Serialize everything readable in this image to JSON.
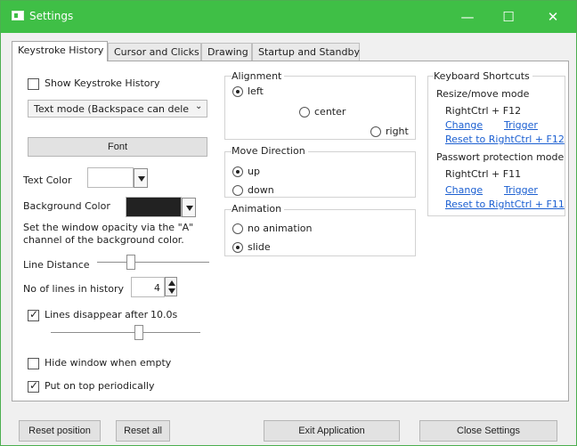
{
  "window": {
    "title": "Settings",
    "controls": {
      "minimize": "—",
      "maximize": "☐",
      "close": "✕"
    }
  },
  "tabs": [
    {
      "label": "Keystroke History",
      "active": true
    },
    {
      "label": "Cursor and Clicks",
      "active": false
    },
    {
      "label": "Drawing",
      "active": false
    },
    {
      "label": "Startup and Standby",
      "active": false
    }
  ],
  "keystroke_history": {
    "show_label": "Show Keystroke History",
    "mode_value": "Text mode (Backspace can dele",
    "font_button": "Font",
    "text_color_label": "Text Color",
    "background_color_label": "Background Color",
    "opacity_help": "Set the window opacity via the \"A\" channel of the background color.",
    "line_distance_label": "Line Distance",
    "lines_history_label": "No of lines in history",
    "lines_history_value": "4",
    "lines_disappear_label": "Lines disappear after",
    "lines_disappear_value": "10.0s",
    "hide_when_empty_label": "Hide window when empty",
    "put_on_top_label": "Put on top periodically"
  },
  "alignment": {
    "title": "Alignment",
    "left": "left",
    "center": "center",
    "right": "right"
  },
  "move_direction": {
    "title": "Move Direction",
    "up": "up",
    "down": "down"
  },
  "animation": {
    "title": "Animation",
    "none": "no animation",
    "slide": "slide"
  },
  "shortcuts": {
    "title": "Keyboard Shortcuts",
    "resize_title": "Resize/move mode",
    "resize_value": "RightCtrl + F12",
    "resize_change": "Change",
    "resize_trigger": "Trigger",
    "resize_reset": "Reset to RightCtrl + F12",
    "password_title": "Passwort protection mode",
    "password_value": "RightCtrl + F11",
    "password_change": "Change",
    "password_trigger": "Trigger",
    "password_reset": "Reset to RightCtrl + F11"
  },
  "footer": {
    "reset_position": "Reset position",
    "reset_all": "Reset all",
    "exit": "Exit Application",
    "close": "Close Settings"
  },
  "colors": {
    "titlebar": "#3fbf46",
    "background_color_swatch": "#222222",
    "link": "#1b5fd1"
  }
}
